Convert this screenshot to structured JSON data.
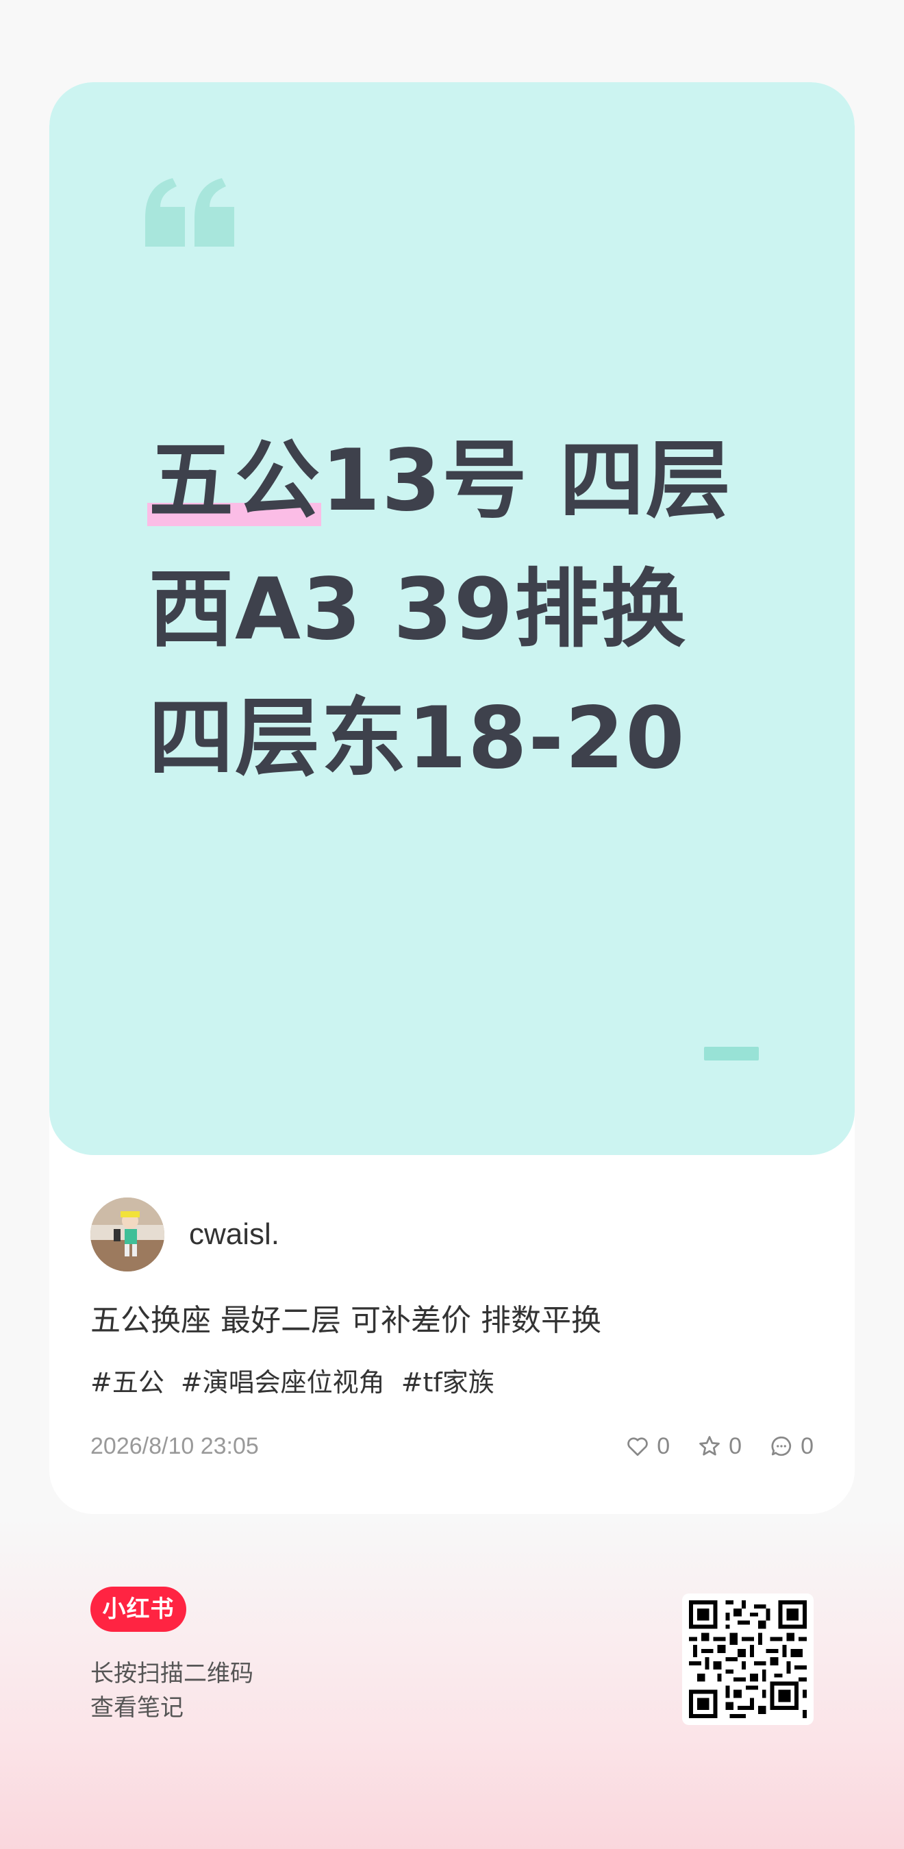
{
  "cover": {
    "lines": [
      {
        "highlight": "五公",
        "rest": "13号 四层"
      },
      {
        "text": "西A3 39排换"
      },
      {
        "text": "四层东18-20"
      }
    ]
  },
  "author": {
    "name": "cwaisl."
  },
  "note": {
    "title": "五公换座 最好二层 可补差价 排数平换",
    "tags": [
      "#五公",
      "#演唱会座位视角",
      "#tf家族"
    ],
    "date": "2026/8/10 23:05",
    "likes": "0",
    "collects": "0",
    "comments": "0"
  },
  "footer": {
    "logo_text": "小红书",
    "hint_line1": "长按扫描二维码",
    "hint_line2": "查看笔记"
  },
  "colors": {
    "cover_bg": "#ccf4f1",
    "highlight": "#fbbde6",
    "brand": "#ff2442",
    "text": "#3e414c"
  }
}
